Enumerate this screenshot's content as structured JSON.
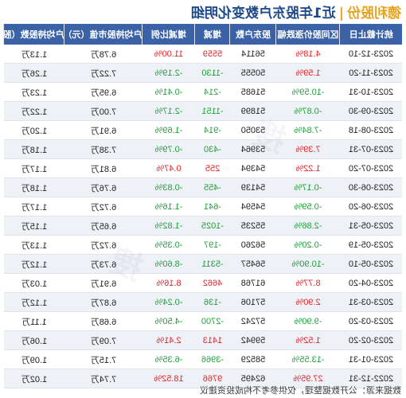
{
  "title": {
    "company": "德利股份",
    "separator": "|",
    "text": "近1年股东户数变化明细"
  },
  "columns": [
    "统计截止日",
    "区间股价涨跌幅",
    "股东户数",
    "增减",
    "增减比例",
    "户均持股市值（元）",
    "户均持股数（股）"
  ],
  "rows": [
    {
      "date": "2023-12-10",
      "chg": "4.18%",
      "holders": "56114",
      "delta": "5559",
      "ratio": "11.00%",
      "value": "6.78万",
      "shares": "1.13万"
    },
    {
      "date": "2023-11-20",
      "chg": "1.59%",
      "holders": "50555",
      "delta": "-1130",
      "ratio": "-2.19%",
      "value": "7.22万",
      "shares": "1.26万"
    },
    {
      "date": "2023-10-31",
      "chg": "-10.59%",
      "holders": "51685",
      "delta": "-214",
      "ratio": "-0.41%",
      "value": "6.95万",
      "shares": "1.23万"
    },
    {
      "date": "2023-09-30",
      "chg": "-0.87%",
      "holders": "51899",
      "delta": "-1151",
      "ratio": "-2.17%",
      "value": "7.00万",
      "shares": "1.22万"
    },
    {
      "date": "2023-08-18",
      "chg": "-7.84%",
      "holders": "53050",
      "delta": "-914",
      "ratio": "-1.69%",
      "value": "6.91万",
      "shares": "1.20万"
    },
    {
      "date": "2023-07-31",
      "chg": "7.39%",
      "holders": "53964",
      "delta": "-430",
      "ratio": "-0.79%",
      "value": "7.38万",
      "shares": "1.18万"
    },
    {
      "date": "2023-07-20",
      "chg": "1.22%",
      "holders": "54394",
      "delta": "255",
      "ratio": "0.47%",
      "value": "6.81万",
      "shares": "1.17万"
    },
    {
      "date": "2023-06-30",
      "chg": "-0.17%",
      "holders": "54139",
      "delta": "-455",
      "ratio": "-0.83%",
      "value": "6.76万",
      "shares": "1.18万"
    },
    {
      "date": "2023-06-20",
      "chg": "-0.59%",
      "holders": "54594",
      "delta": "-641",
      "ratio": "-1.16%",
      "value": "6.72万",
      "shares": "1.17万"
    },
    {
      "date": "2023-05-31",
      "chg": "-2.86%",
      "holders": "55235",
      "delta": "-1025",
      "ratio": "-1.82%",
      "value": "6.65万",
      "shares": "1.15万"
    },
    {
      "date": "2023-05-19",
      "chg": "-0.20%",
      "holders": "56260",
      "delta": "-197",
      "ratio": "-0.35%",
      "value": "6.72万",
      "shares": "1.13万"
    },
    {
      "date": "2023-05-10",
      "chg": "-10.90%",
      "holders": "56457",
      "delta": "-5311",
      "ratio": "-8.60%",
      "value": "6.73万",
      "shares": "1.12万"
    },
    {
      "date": "2023-04-20",
      "chg": "8.77%",
      "holders": "61768",
      "delta": "4662",
      "ratio": "8.16%",
      "value": "6.91万",
      "shares": "1.03万"
    },
    {
      "date": "2023-03-31",
      "chg": "2.90%",
      "holders": "57106",
      "delta": "-136",
      "ratio": "-0.24%",
      "value": "6.87万",
      "shares": "1.12万"
    },
    {
      "date": "2023-03-20",
      "chg": "-9.90%",
      "holders": "57242",
      "delta": "-2700",
      "ratio": "-4.50%",
      "value": "6.68万",
      "shares": "1.11万"
    },
    {
      "date": "2023-02-20",
      "chg": "1.52%",
      "holders": "59942",
      "delta": "1413",
      "ratio": "2.41%",
      "value": "7.09万",
      "shares": "1.06万"
    },
    {
      "date": "2023-01-31",
      "chg": "-13.55%",
      "holders": "58529",
      "delta": "-3966",
      "ratio": "-6.35%",
      "value": "7.15万",
      "shares": "1.09万"
    },
    {
      "date": "2022-12-31",
      "chg": "27.95%",
      "holders": "62495",
      "delta": "9766",
      "ratio": "18.52%",
      "value": "7.74万",
      "shares": "1.02万"
    }
  ],
  "footer": "数据来源：公开数据整理，仅供参考不构成投资建议",
  "colors": {
    "header": "#3b62a6",
    "up": "#e0262b",
    "down": "#22a03a",
    "title": "#1e4b8c",
    "accent": "#e8a21a"
  }
}
